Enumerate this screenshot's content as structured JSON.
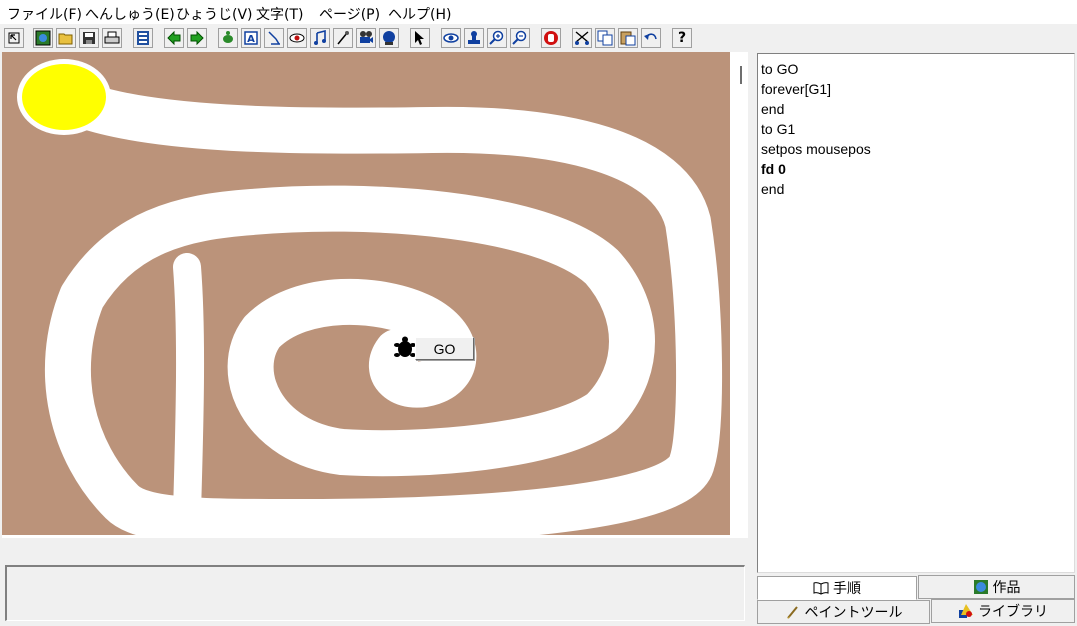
{
  "menu": [
    {
      "label": "ファイル(F)"
    },
    {
      "label": "へんしゅう(E)"
    },
    {
      "label": "ひょうじ(V)"
    },
    {
      "label": "文字(T)"
    },
    {
      "label": "ページ(P)"
    },
    {
      "label": "ヘルプ(H)"
    }
  ],
  "toolbar": {
    "icons": [
      "cursor-icon",
      "projects-icon",
      "open-icon",
      "save-icon",
      "print-icon",
      "page-icon",
      "back-icon",
      "forward-icon",
      "new-turtle-icon",
      "text-box-icon",
      "button-icon",
      "slider-icon",
      "sound-icon",
      "melody-icon",
      "video-icon",
      "record-icon",
      "pointer-icon",
      "eye-icon",
      "stamp-icon",
      "zoom-in-icon",
      "zoom-out-icon",
      "stop-icon",
      "cut-icon",
      "copy-icon",
      "paste-icon",
      "undo-icon",
      "help-icon"
    ]
  },
  "canvas": {
    "colors": {
      "ground": "#bb937a",
      "path": "#ffffff",
      "goal": "#ffff00"
    },
    "go_button": {
      "label": "GO"
    },
    "turtle": {
      "icon": "turtle-icon"
    }
  },
  "procedures": {
    "lines": [
      {
        "text": "to GO",
        "bold": false
      },
      {
        "text": "forever[G1]",
        "bold": false
      },
      {
        "text": "end",
        "bold": false
      },
      {
        "text": "to G1",
        "bold": false
      },
      {
        "text": "setpos mousepos",
        "bold": false
      },
      {
        "text": "fd 0",
        "bold": true
      },
      {
        "text": "end",
        "bold": false
      }
    ]
  },
  "tabs": {
    "procedures": {
      "label": "手順",
      "icon": "book-icon"
    },
    "projects": {
      "label": "作品",
      "icon": "globe-icon"
    },
    "paint": {
      "label": "ペイントツール",
      "icon": "brush-icon"
    },
    "library": {
      "label": "ライブラリ",
      "icon": "shapes-icon"
    }
  },
  "message": {
    "text": ""
  }
}
